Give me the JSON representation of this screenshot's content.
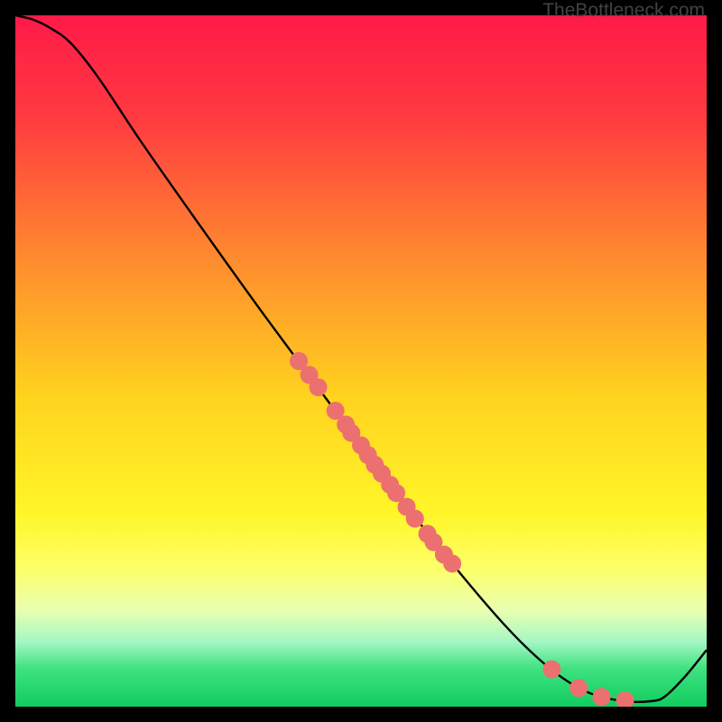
{
  "watermark": "TheBottleneck.com",
  "chart_data": {
    "type": "line",
    "title": "",
    "xlabel": "",
    "ylabel": "",
    "xlim": [
      0,
      100
    ],
    "ylim": [
      0,
      100
    ],
    "gradient_stops": [
      {
        "offset": 0.0,
        "color": "#ff1a49"
      },
      {
        "offset": 0.15,
        "color": "#ff3b40"
      },
      {
        "offset": 0.35,
        "color": "#ff8a2f"
      },
      {
        "offset": 0.55,
        "color": "#ffd21e"
      },
      {
        "offset": 0.72,
        "color": "#fff628"
      },
      {
        "offset": 0.8,
        "color": "#fdff69"
      },
      {
        "offset": 0.86,
        "color": "#e9ffb0"
      },
      {
        "offset": 0.905,
        "color": "#a7f7c5"
      },
      {
        "offset": 0.945,
        "color": "#3ee27f"
      },
      {
        "offset": 1.0,
        "color": "#11cc5e"
      }
    ],
    "curve": [
      {
        "x": 0.0,
        "y": 100.0
      },
      {
        "x": 2.5,
        "y": 99.4
      },
      {
        "x": 5.0,
        "y": 98.2
      },
      {
        "x": 8.0,
        "y": 96.0
      },
      {
        "x": 12.0,
        "y": 91.0
      },
      {
        "x": 18.0,
        "y": 82.0
      },
      {
        "x": 25.0,
        "y": 72.0
      },
      {
        "x": 35.0,
        "y": 58.0
      },
      {
        "x": 45.0,
        "y": 44.5
      },
      {
        "x": 55.0,
        "y": 31.0
      },
      {
        "x": 65.0,
        "y": 18.5
      },
      {
        "x": 72.0,
        "y": 10.5
      },
      {
        "x": 78.0,
        "y": 5.0
      },
      {
        "x": 83.0,
        "y": 2.0
      },
      {
        "x": 88.0,
        "y": 0.8
      },
      {
        "x": 92.0,
        "y": 0.8
      },
      {
        "x": 94.0,
        "y": 1.5
      },
      {
        "x": 97.0,
        "y": 4.5
      },
      {
        "x": 100.0,
        "y": 8.2
      }
    ],
    "markers": [
      {
        "x": 41.0,
        "y": 50.0
      },
      {
        "x": 42.5,
        "y": 48.0
      },
      {
        "x": 43.8,
        "y": 46.2
      },
      {
        "x": 46.3,
        "y": 42.8
      },
      {
        "x": 47.8,
        "y": 40.8
      },
      {
        "x": 48.6,
        "y": 39.6
      },
      {
        "x": 50.0,
        "y": 37.8
      },
      {
        "x": 51.0,
        "y": 36.4
      },
      {
        "x": 52.0,
        "y": 35.0
      },
      {
        "x": 53.0,
        "y": 33.7
      },
      {
        "x": 54.2,
        "y": 32.1
      },
      {
        "x": 55.1,
        "y": 30.9
      },
      {
        "x": 56.6,
        "y": 28.9
      },
      {
        "x": 57.8,
        "y": 27.2
      },
      {
        "x": 59.6,
        "y": 25.0
      },
      {
        "x": 60.5,
        "y": 23.8
      },
      {
        "x": 62.0,
        "y": 22.0
      },
      {
        "x": 63.2,
        "y": 20.7
      },
      {
        "x": 77.6,
        "y": 5.4
      },
      {
        "x": 81.5,
        "y": 2.7
      },
      {
        "x": 84.8,
        "y": 1.4
      },
      {
        "x": 88.2,
        "y": 0.9
      }
    ],
    "marker_color": "#ec7070",
    "marker_radius": 10,
    "line_color": "#000000"
  }
}
